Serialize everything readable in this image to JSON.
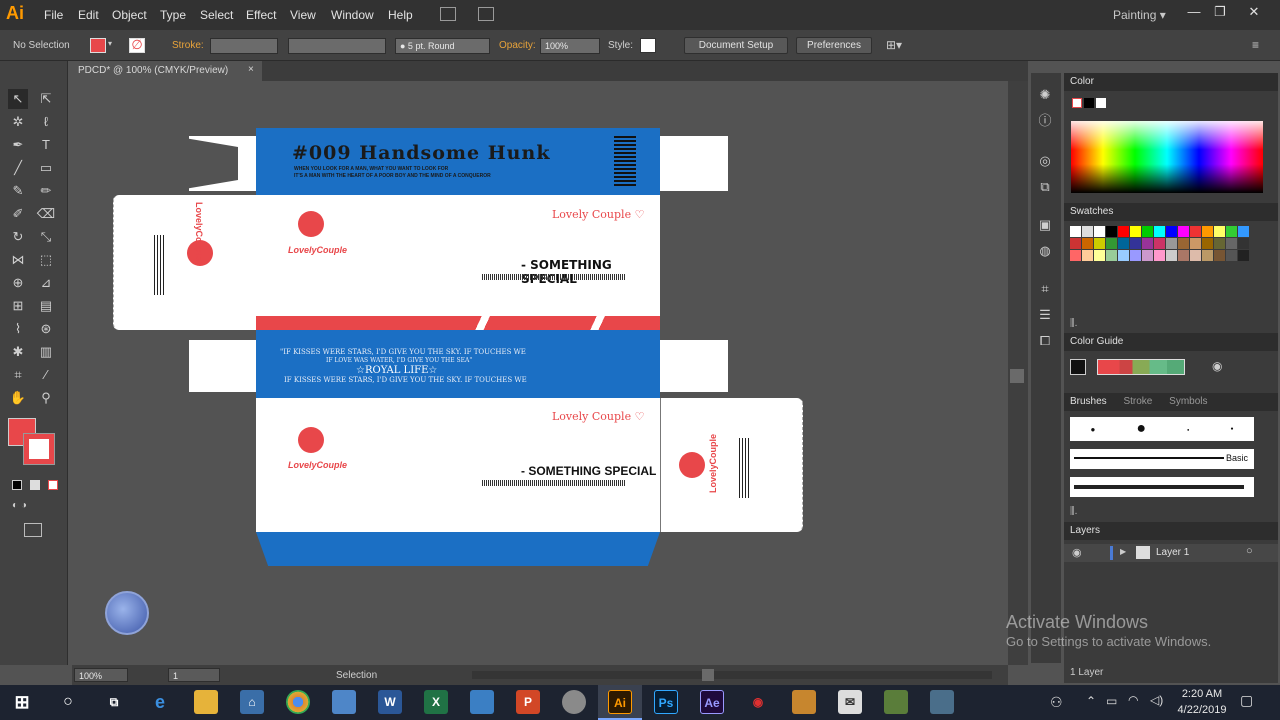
{
  "app": {
    "logo": "Ai",
    "workspace": "Painting ▾"
  },
  "menu": [
    "File",
    "Edit",
    "Object",
    "Type",
    "Select",
    "Effect",
    "View",
    "Window",
    "Help"
  ],
  "control": {
    "selection": "No Selection",
    "stroke_label": "Stroke:",
    "brush": "● 5 pt. Round",
    "opacity_label": "Opacity:",
    "opacity_value": "100%",
    "style_label": "Style:",
    "doc_setup": "Document Setup",
    "preferences": "Preferences"
  },
  "document": {
    "tab": "PDCD* @ 100% (CMYK/Preview)"
  },
  "artwork": {
    "top_title": "#009 Handsome Hunk",
    "top_sub1": "WHEN YOU LOOK FOR A MAN, WHAT YOU WANT TO LOOK FOR",
    "top_sub2": "IT'S A MAN WITH THE HEART OF A POOR BOY AND THE MIND OF A CONQUEROR",
    "brand": "LovelyCouple",
    "brand_tag": "Lovely Couple ♡",
    "special": "- SOMETHING SPECIAL",
    "mid_line1": "\"IF KISSES WERE STARS, I'D GIVE YOU THE SKY. IF TOUCHES WE",
    "mid_line2": "IF LOVE WAS WATER, I'D GIVE YOU THE SEA\"",
    "royal": "☆ROYAL LIFE☆",
    "mid_line3": "IF KISSES WERE STARS, I'D GIVE YOU THE SKY. IF TOUCHES WE"
  },
  "status": {
    "zoom": "100%",
    "artboard": "1",
    "tool": "Selection"
  },
  "panels": {
    "color": "Color",
    "swatches": "Swatches",
    "color_guide": "Color Guide",
    "brushes": "Brushes",
    "stroke": "Stroke",
    "symbols": "Symbols",
    "basic": "Basic",
    "layers": "Layers",
    "layer1": "Layer 1",
    "layer_count": "1 Layer"
  },
  "watermark": {
    "title": "Activate Windows",
    "sub": "Go to Settings to activate Windows."
  },
  "taskbar": {
    "time": "2:20 AM",
    "date": "4/22/2019"
  },
  "colors": {
    "accent_red": "#e8474a",
    "box_blue": "#1b6fc4",
    "ai_orange": "#ff9a00"
  }
}
